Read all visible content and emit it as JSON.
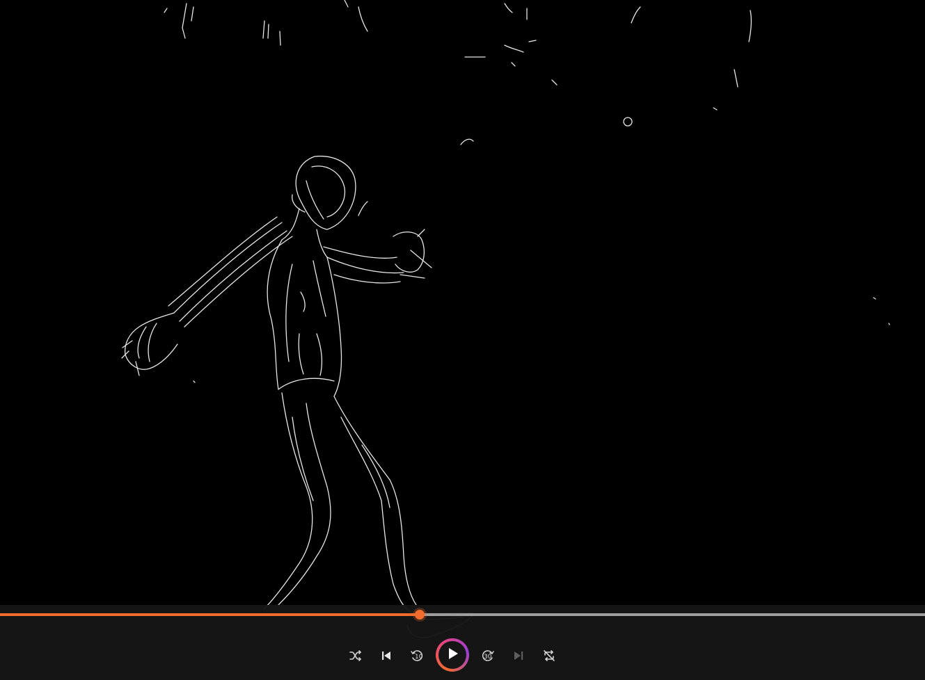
{
  "player": {
    "progress_fraction": 0.454,
    "accent_color": "#f26b2d",
    "play_ring_colors": [
      "#f26b2d",
      "#e8457e",
      "#9b3fd6"
    ]
  },
  "controls": {
    "shuffle": {
      "icon": "shuffle-icon"
    },
    "previous": {
      "icon": "skip-previous-icon"
    },
    "rewind": {
      "icon": "rewind-10-icon",
      "label": "10"
    },
    "play": {
      "icon": "play-icon"
    },
    "forward": {
      "icon": "forward-30-icon",
      "label": "30"
    },
    "next": {
      "icon": "skip-next-icon",
      "enabled": false
    },
    "repeat": {
      "icon": "repeat-off-icon"
    }
  }
}
